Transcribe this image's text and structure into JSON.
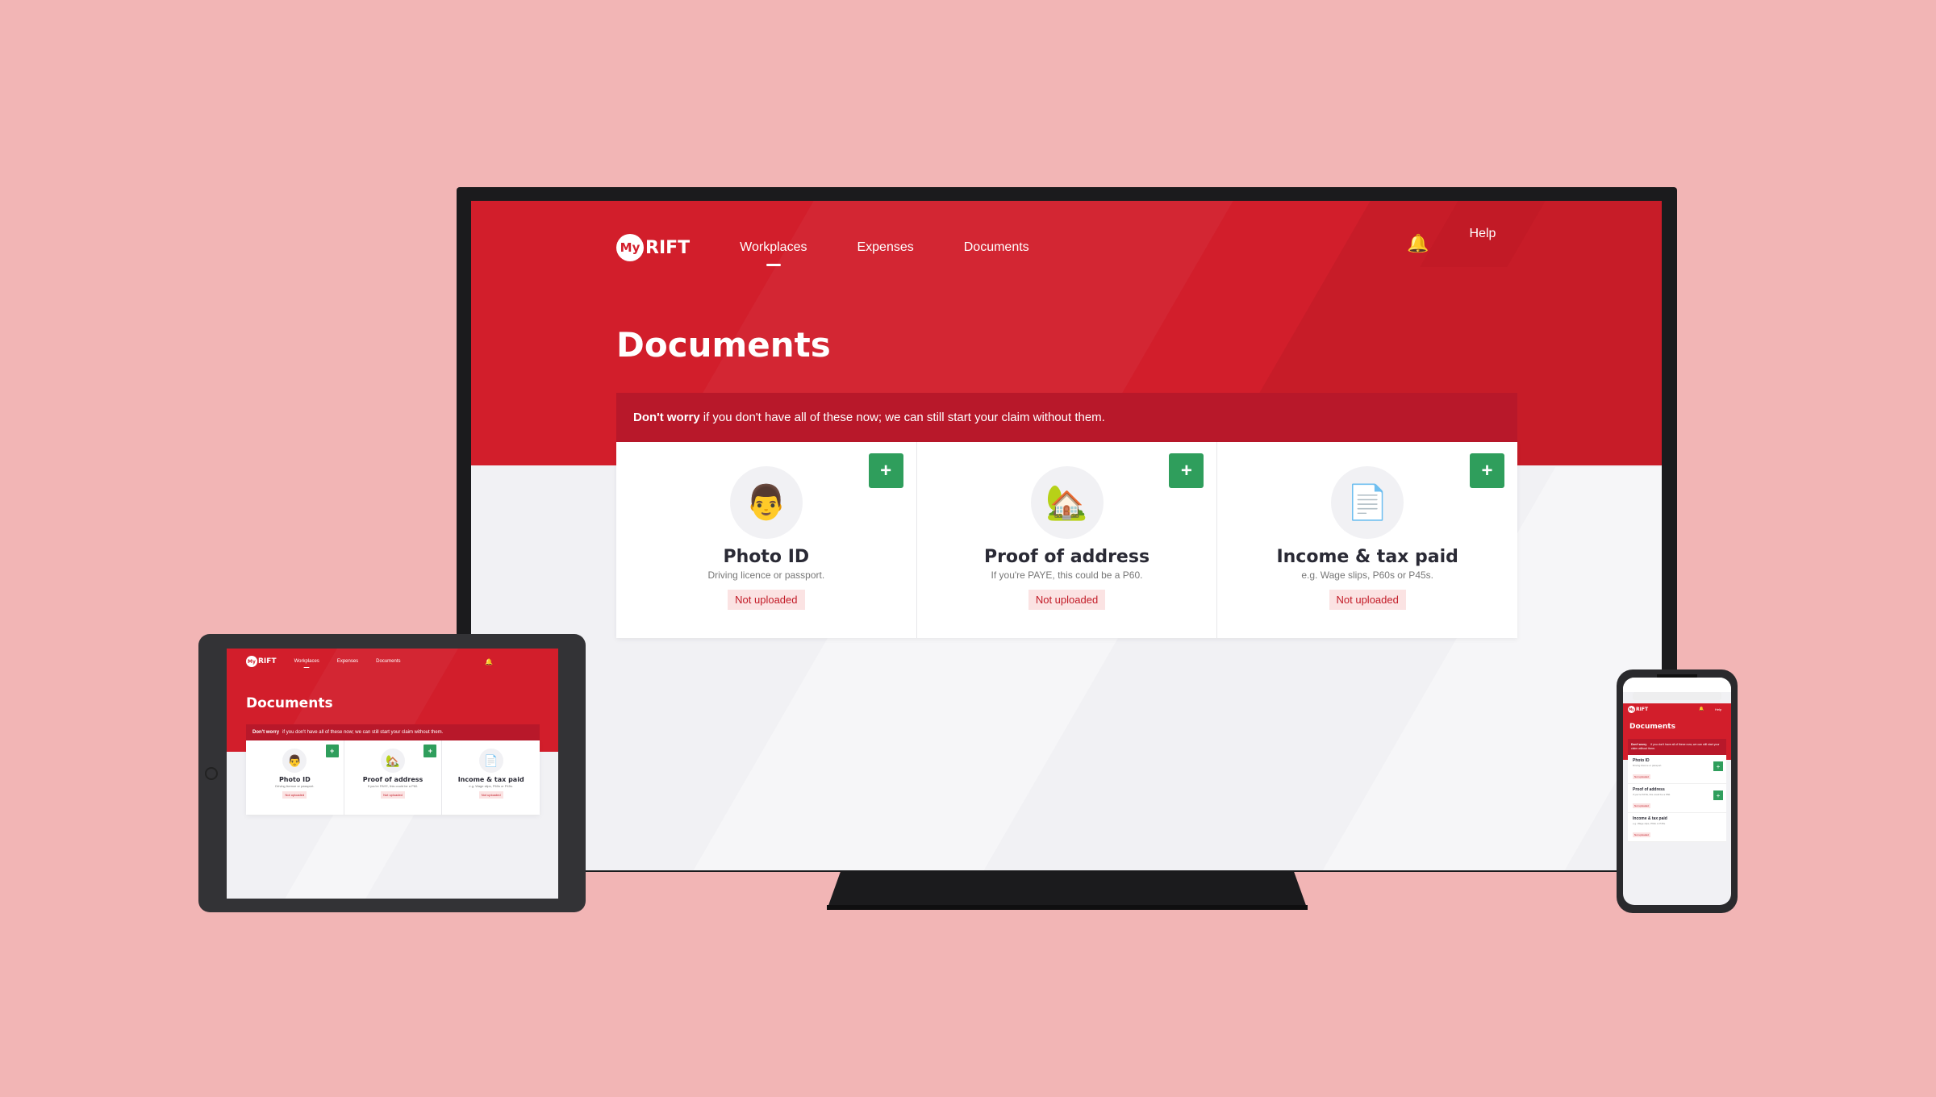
{
  "brand": {
    "logo_badge": "My",
    "logo_text": "RIFT",
    "primary_color": "#d21e2b",
    "accent_green": "#2f9e5c",
    "background": "#f2b5b5"
  },
  "nav": {
    "items": [
      {
        "label": "Workplaces",
        "active": true
      },
      {
        "label": "Expenses",
        "active": false
      },
      {
        "label": "Documents",
        "active": false
      }
    ],
    "bell_icon": "bell-icon",
    "help_label": "Help"
  },
  "page": {
    "title": "Documents",
    "notice_bold": "Don't worry",
    "notice_text": "if you don't have all of these now; we can still start your claim without them."
  },
  "cards": [
    {
      "title": "Photo ID",
      "subtitle": "Driving licence or passport.",
      "status": "Not uploaded",
      "icon": "person-icon",
      "add_label": "+"
    },
    {
      "title": "Proof of address",
      "subtitle": "If you're PAYE, this could be a P60.",
      "status": "Not uploaded",
      "icon": "house-icon",
      "add_label": "+"
    },
    {
      "title": "Income & tax paid",
      "subtitle": "e.g. Wage slips, P60s or P45s.",
      "status": "Not uploaded",
      "icon": "document-icon",
      "add_label": "+"
    }
  ]
}
